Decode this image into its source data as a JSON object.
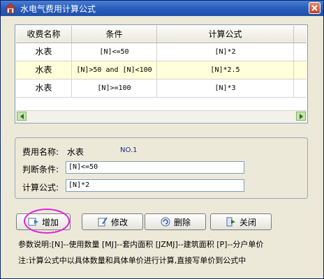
{
  "window": {
    "title": "水电气费用计算公式"
  },
  "grid": {
    "headers": [
      "收费名称",
      "条件",
      "计算公式"
    ],
    "rows": [
      {
        "name": "水表",
        "condition": "[N]<=50",
        "formula": "[N]*2"
      },
      {
        "name": "水表",
        "condition": "[N]>50 and [N]<100",
        "formula": "[N]*2.5"
      },
      {
        "name": "水表",
        "condition": "[N]>=100",
        "formula": "[N]*3"
      }
    ]
  },
  "form": {
    "name_label": "费用名称:",
    "name_value": "水表",
    "number": "NO.1",
    "condition_label": "判断条件:",
    "condition_value": "[N]<=50",
    "formula_label": "计算公式:",
    "formula_value": "[N]*2"
  },
  "buttons": {
    "add": "增加",
    "edit": "修改",
    "delete": "删除",
    "close": "关闭"
  },
  "notes": {
    "params": "参数说明:[N]--使用数量 [MJ]--套内面积 [JZMJ]--建筑面积 [P]--分户单价",
    "tip": "注:计算公式中以具体数量和具体单价进行计算,直接写单价到公式中"
  },
  "colors": {
    "selected_row": "#ffffd9",
    "title_bar": "#2a5fbf",
    "highlight_ring": "#e020e0"
  }
}
